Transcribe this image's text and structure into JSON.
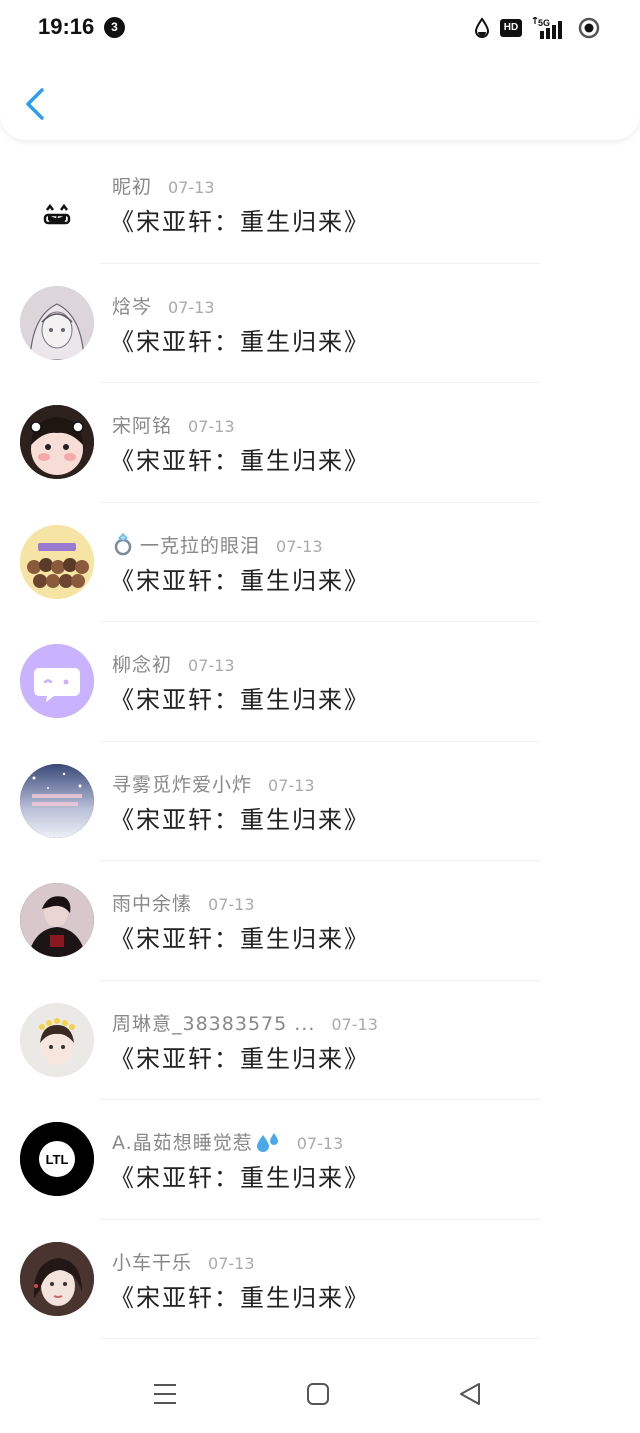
{
  "status": {
    "time": "19:16",
    "notif_count": "3",
    "hd": "HD",
    "network": "5G"
  },
  "message_text": "《宋亚轩：重生归来》",
  "items": [
    {
      "name": "昵初",
      "date": "07-13",
      "avatar": "emoji-face"
    },
    {
      "name": "焓岑",
      "date": "07-13",
      "avatar": "sketch-girl"
    },
    {
      "name": "宋阿铭",
      "date": "07-13",
      "avatar": "baby-face"
    },
    {
      "name": "一克拉的眼泪",
      "date": "07-13",
      "avatar": "group-cartoon",
      "prefix_icon": "ring-icon"
    },
    {
      "name": "柳念初",
      "date": "07-13",
      "avatar": "chat-bubble"
    },
    {
      "name": "寻雾觅炸爱小炸",
      "date": "07-13",
      "avatar": "night-sky"
    },
    {
      "name": "雨中余愫",
      "date": "07-13",
      "avatar": "dark-person"
    },
    {
      "name": "周琳意_38383575 ...",
      "date": "07-13",
      "avatar": "girl-flower-crown"
    },
    {
      "name": "A.晶茹想睡觉惹",
      "date": "07-13",
      "avatar": "ltl-logo",
      "suffix_icon": "sweat-drops-icon",
      "logo_text": "LTL"
    },
    {
      "name": "小车干乐",
      "date": "07-13",
      "avatar": "girl-portrait"
    }
  ],
  "colors": {
    "accent": "#2a9df4",
    "avatar_purple": "#c9b3ff",
    "name_gray": "#888888",
    "date_gray": "#aaaaaa"
  }
}
